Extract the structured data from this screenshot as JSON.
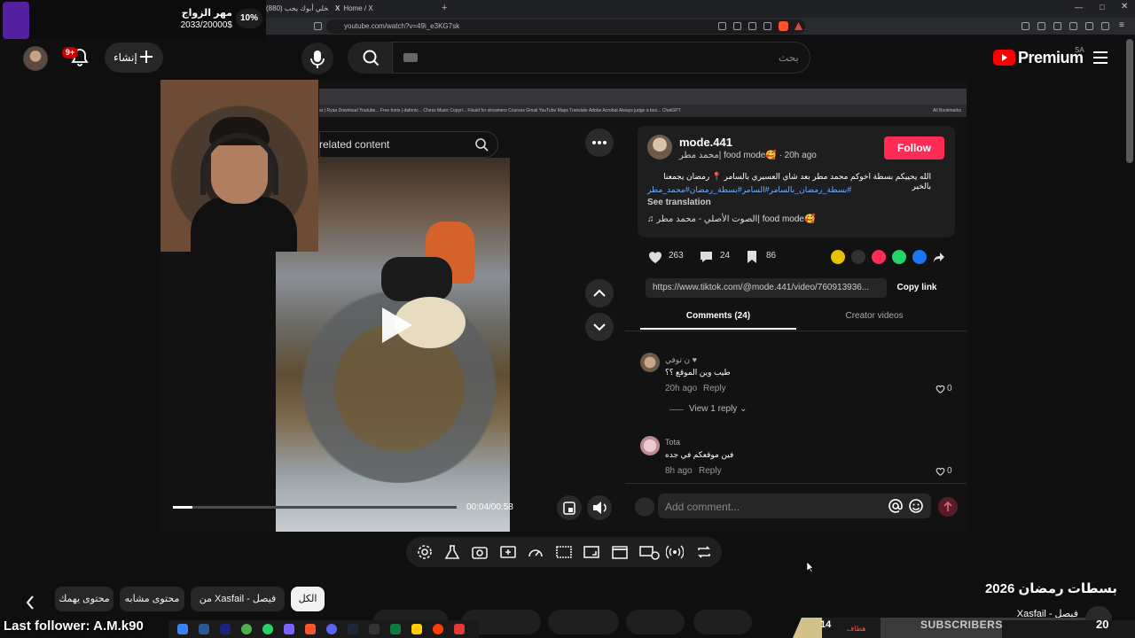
{
  "browser": {
    "tabs": [
      {
        "label": "(880) كيف تخلي أبوك يحب"
      },
      {
        "label": "Home / X"
      }
    ],
    "url": "youtube.com/watch?v=49i_e3KG7sk"
  },
  "overlay_marriage": {
    "title": "مهر الزواج",
    "amount": "2033/20000$",
    "percent": "10%",
    "progress": 0.1
  },
  "header": {
    "notifications": "9+",
    "create_label": "إنشاء",
    "search_placeholder": "بحث",
    "logo_text": "Premium",
    "country": "SA"
  },
  "player": {
    "time": "00:04/00:58",
    "progress": 0.0688,
    "toolbar_icons": [
      "settings-icon",
      "lab-icon",
      "screenshot-icon",
      "caption-add-icon",
      "speed-icon",
      "subtitles-icon",
      "theater-icon",
      "clapper-icon",
      "visible-icon",
      "live-icon",
      "loop-icon"
    ]
  },
  "tiktok": {
    "search_label": "related content",
    "bookmarks": "ar | Ryaa   Download Youtube...   Free fonts | dafontc...   Chess Music Copyri...   Flould for streamers   Courses   Gmail   YouTube   Maps   Translate   Adobe Acrobat   Always judge a boo...   ChatGPT",
    "all_bookmarks": "All Bookmarks",
    "creator": {
      "name": "mode.441",
      "subtitle": "محمد مطر| food mode🥰 · 20h ago",
      "follow": "Follow"
    },
    "caption_line1": "الله يحييكم بسطة اخوكم محمد مطر بعد شاي العسيري بالسامر 📍 رمضان يجمعنا بالخير",
    "caption_line2": "#بسطة_رمضان_بالسامر#السامر#بسطة_رمضان#محمد_مطر",
    "see_translation": "See translation",
    "music": "♫ الصوت الأصلي - محمد مطر| food mode🥰",
    "stats": {
      "likes": "263",
      "comments": "24",
      "saves": "86"
    },
    "link": "https://www.tiktok.com/@mode.441/video/760913936...",
    "copy_link": "Copy link",
    "tabs": {
      "comments": "Comments (24)",
      "creator_videos": "Creator videos"
    },
    "comments": [
      {
        "name": "ن توفي ♥",
        "text": "طيب وين الموقع ؟؟",
        "time": "20h ago",
        "reply": "Reply",
        "likes": "0"
      },
      {
        "name": "Tota",
        "text": "فين موقعكم في جده",
        "time": "8h ago",
        "reply": "Reply",
        "likes": "0"
      }
    ],
    "view_reply": "View 1 reply",
    "add_comment": "Add comment..."
  },
  "chips": {
    "all": "الكل",
    "from": "من Xasfail - فيصل",
    "similar": "محتوى مشابه",
    "interest": "محتوى يهمك"
  },
  "recommended": {
    "title": "بسطات رمضان 2026",
    "channel": "Xasfail - فيصل"
  },
  "stream": {
    "last_follower": "Last follower: A.M.k90",
    "subs_count": "14",
    "subs_label": "SUBSCRIBERS",
    "subs_ar": "هطاف",
    "tray_number": "20"
  },
  "colors": {
    "background": "#0f0f0f",
    "youtube_red": "#ff0000",
    "tiktok_red": "#fe2c55",
    "overlay_purple": "#7b2cf5"
  }
}
